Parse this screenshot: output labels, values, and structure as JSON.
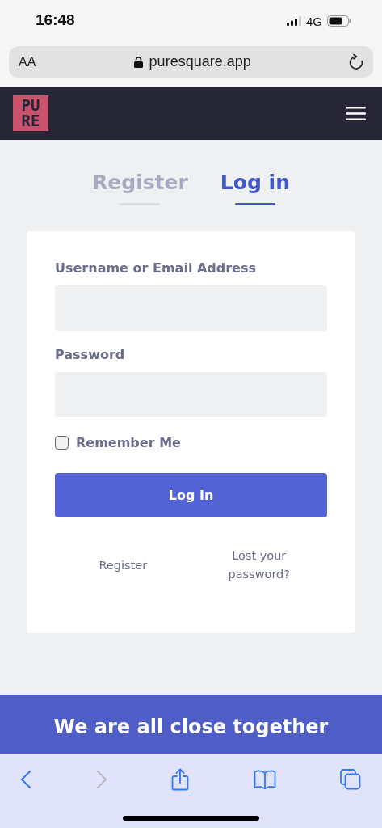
{
  "status_bar": {
    "time": "16:48",
    "network": "4G"
  },
  "address_bar": {
    "text_size": "AA",
    "url": "puresquare.app"
  },
  "site_header": {
    "logo_lines": [
      "PU",
      "RE"
    ]
  },
  "tabs": [
    {
      "label": "Register",
      "selected": false
    },
    {
      "label": "Log in",
      "selected": true
    }
  ],
  "login_form": {
    "username_label": "Username or Email Address",
    "password_label": "Password",
    "remember_label": "Remember Me",
    "remember_checked": false,
    "submit": "Log In",
    "links": [
      "Register",
      "Lost your password?"
    ]
  },
  "footer": {
    "heading": "We are all close together"
  },
  "toolbar": {
    "forward_disabled": true
  }
}
